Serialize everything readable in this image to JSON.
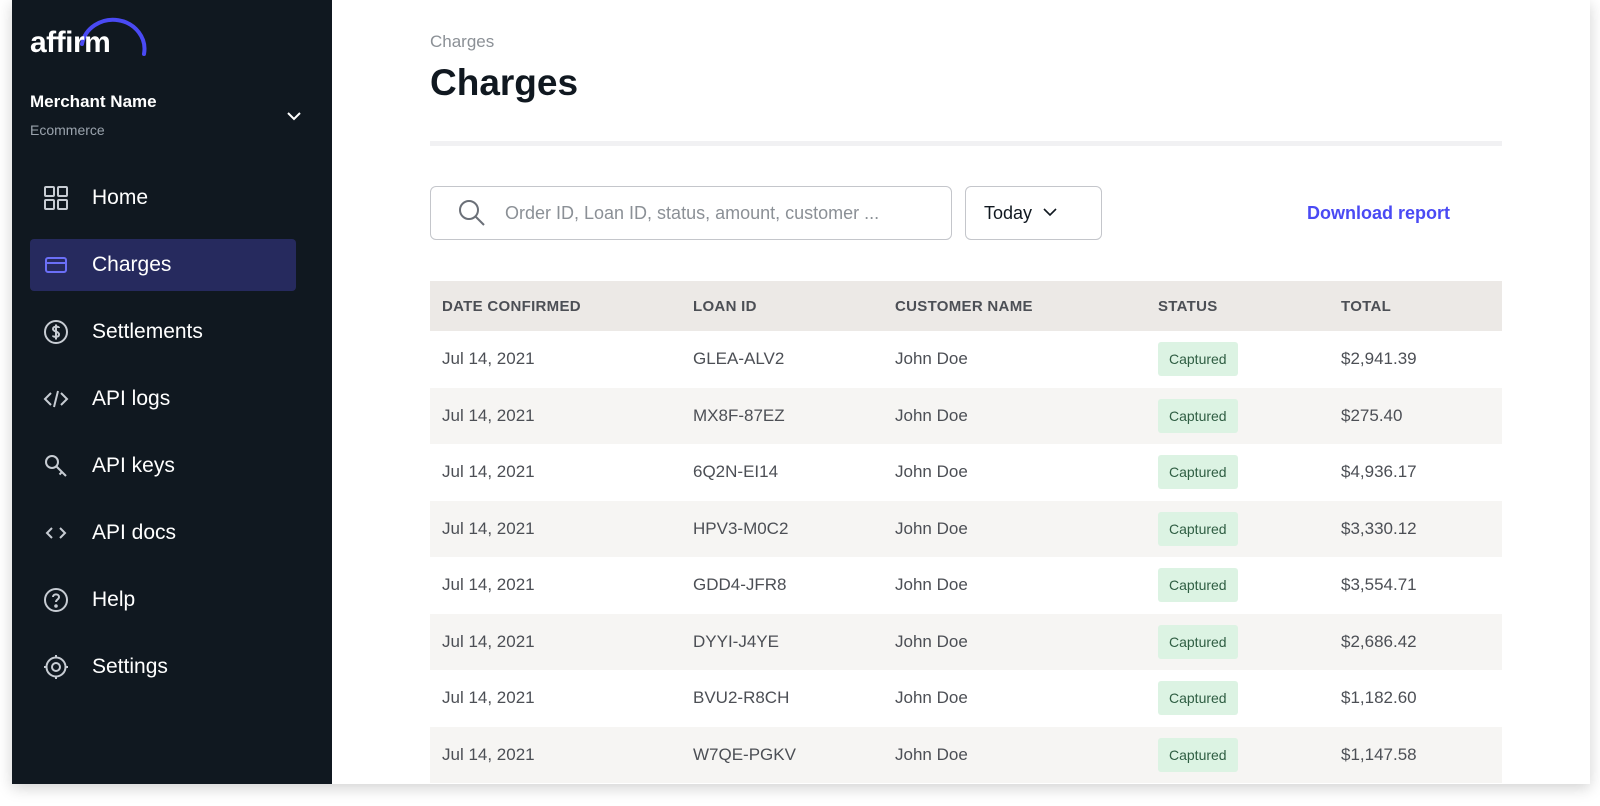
{
  "brand": {
    "logo_text": "affirm",
    "accent_color": "#4a4af4"
  },
  "merchant": {
    "name": "Merchant Name",
    "type": "Ecommerce"
  },
  "sidebar": {
    "items": [
      {
        "label": "Home",
        "icon": "grid-icon",
        "active": false
      },
      {
        "label": "Charges",
        "icon": "card-icon",
        "active": true
      },
      {
        "label": "Settlements",
        "icon": "dollar-icon",
        "active": false
      },
      {
        "label": "API logs",
        "icon": "code-icon",
        "active": false
      },
      {
        "label": "API keys",
        "icon": "key-icon",
        "active": false
      },
      {
        "label": "API docs",
        "icon": "brackets-icon",
        "active": false
      },
      {
        "label": "Help",
        "icon": "help-icon",
        "active": false
      },
      {
        "label": "Settings",
        "icon": "gear-icon",
        "active": false
      }
    ]
  },
  "main": {
    "breadcrumb": "Charges",
    "title": "Charges",
    "search": {
      "placeholder": "Order ID, Loan ID, status, amount, customer ..."
    },
    "date_range": "Today",
    "download_label": "Download report"
  },
  "table": {
    "headers": [
      "DATE CONFIRMED",
      "LOAN ID",
      "CUSTOMER NAME",
      "STATUS",
      "TOTAL"
    ],
    "rows": [
      {
        "date": "Jul 14, 2021",
        "loan_id": "GLEA-ALV2",
        "customer": "John Doe",
        "status": "Captured",
        "total": "$2,941.39"
      },
      {
        "date": "Jul 14, 2021",
        "loan_id": "MX8F-87EZ",
        "customer": "John Doe",
        "status": "Captured",
        "total": "$275.40"
      },
      {
        "date": "Jul 14, 2021",
        "loan_id": "6Q2N-EI14",
        "customer": "John Doe",
        "status": "Captured",
        "total": "$4,936.17"
      },
      {
        "date": "Jul 14, 2021",
        "loan_id": "HPV3-M0C2",
        "customer": "John Doe",
        "status": "Captured",
        "total": "$3,330.12"
      },
      {
        "date": "Jul 14, 2021",
        "loan_id": "GDD4-JFR8",
        "customer": "John Doe",
        "status": "Captured",
        "total": "$3,554.71"
      },
      {
        "date": "Jul 14, 2021",
        "loan_id": "DYYI-J4YE",
        "customer": "John Doe",
        "status": "Captured",
        "total": "$2,686.42"
      },
      {
        "date": "Jul 14, 2021",
        "loan_id": "BVU2-R8CH",
        "customer": "John Doe",
        "status": "Captured",
        "total": "$1,182.60"
      },
      {
        "date": "Jul 14, 2021",
        "loan_id": "W7QE-PGKV",
        "customer": "John Doe",
        "status": "Captured",
        "total": "$1,147.58"
      }
    ]
  }
}
